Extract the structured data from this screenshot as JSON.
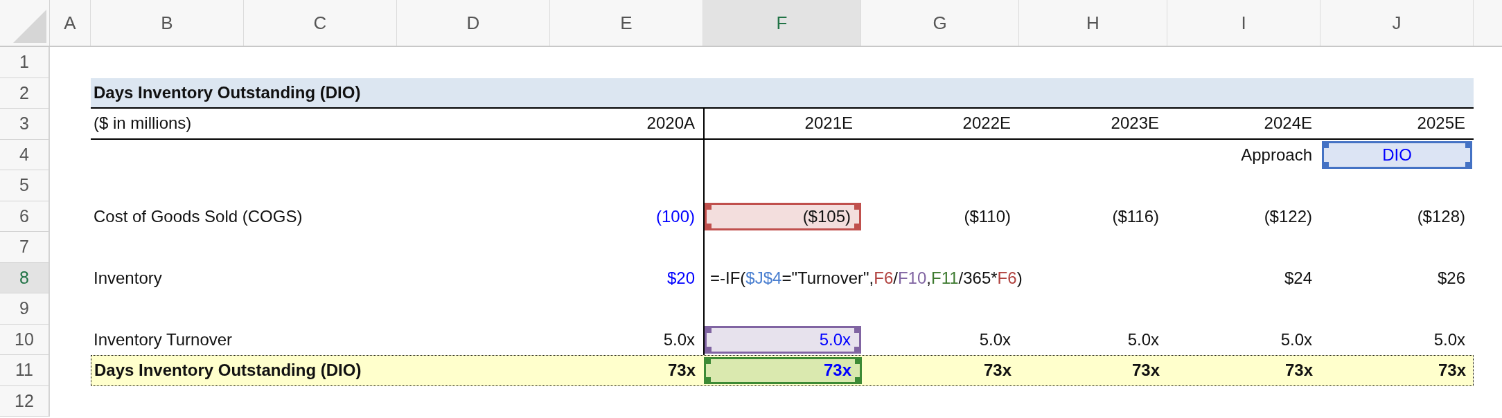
{
  "column_headers": [
    {
      "label": "A",
      "selected": false
    },
    {
      "label": "B",
      "selected": false
    },
    {
      "label": "C",
      "selected": false
    },
    {
      "label": "D",
      "selected": false
    },
    {
      "label": "E",
      "selected": false
    },
    {
      "label": "F",
      "selected": true
    },
    {
      "label": "G",
      "selected": false
    },
    {
      "label": "H",
      "selected": false
    },
    {
      "label": "I",
      "selected": false
    },
    {
      "label": "J",
      "selected": false
    }
  ],
  "rows": [
    {
      "number": "1",
      "selected": false,
      "kind": "blank"
    },
    {
      "number": "2",
      "selected": false,
      "kind": "title",
      "label": "Days Inventory Outstanding (DIO)"
    },
    {
      "number": "3",
      "selected": false,
      "kind": "header",
      "label": "($ in millions)",
      "cells": [
        {
          "text": "2020A"
        },
        {
          "text": "2021E"
        },
        {
          "text": "2022E"
        },
        {
          "text": "2023E"
        },
        {
          "text": "2024E"
        },
        {
          "text": "2025E"
        }
      ]
    },
    {
      "number": "4",
      "selected": false,
      "kind": "approach",
      "label": "Approach",
      "value": {
        "text": "DIO",
        "input": true,
        "color": "#4472c4"
      }
    },
    {
      "number": "5",
      "selected": false,
      "kind": "blank"
    },
    {
      "number": "6",
      "selected": false,
      "kind": "item",
      "label": "Cost of Goods Sold (COGS)",
      "cells": [
        {
          "text": "(100)",
          "input": true
        },
        {
          "text": "($105)",
          "color": "#c0504d"
        },
        {
          "text": "($110)"
        },
        {
          "text": "($116)"
        },
        {
          "text": "($122)"
        },
        {
          "text": "($128)"
        }
      ]
    },
    {
      "number": "7",
      "selected": false,
      "kind": "blank"
    },
    {
      "number": "8",
      "selected": true,
      "kind": "item",
      "label": "Inventory",
      "cells": [
        {
          "text": "$20",
          "input": true
        },
        {
          "kind": "formula",
          "parts": [
            {
              "text": "=-IF("
            },
            {
              "text": "$J$4",
              "color": "#4a7fd0"
            },
            {
              "text": "=\"Turnover\","
            },
            {
              "text": "F6",
              "color": "#b0413e"
            },
            {
              "text": "/"
            },
            {
              "text": "F10",
              "color": "#8064a2"
            },
            {
              "text": ","
            },
            {
              "text": "F11",
              "color": "#3d7a2f"
            },
            {
              "text": "/365*"
            },
            {
              "text": "F6",
              "color": "#b0413e"
            },
            {
              "text": ")"
            }
          ]
        },
        {
          "text": "$24"
        },
        {
          "text": "$26"
        }
      ]
    },
    {
      "number": "9",
      "selected": false,
      "kind": "blank"
    },
    {
      "number": "10",
      "selected": false,
      "kind": "item",
      "label": "Inventory Turnover",
      "cells": [
        {
          "text": "5.0x"
        },
        {
          "text": "5.0x",
          "input": true,
          "color": "#8064a2"
        },
        {
          "text": "5.0x"
        },
        {
          "text": "5.0x"
        },
        {
          "text": "5.0x"
        },
        {
          "text": "5.0x"
        }
      ]
    },
    {
      "number": "11",
      "selected": false,
      "kind": "total",
      "label": "Days Inventory Outstanding (DIO)",
      "cells": [
        {
          "text": "73x"
        },
        {
          "text": "73x",
          "input": true,
          "color": "#3d8a35"
        },
        {
          "text": "73x"
        },
        {
          "text": "73x"
        },
        {
          "text": "73x"
        },
        {
          "text": "73x"
        }
      ]
    },
    {
      "number": "12",
      "selected": false,
      "kind": "blank"
    }
  ]
}
